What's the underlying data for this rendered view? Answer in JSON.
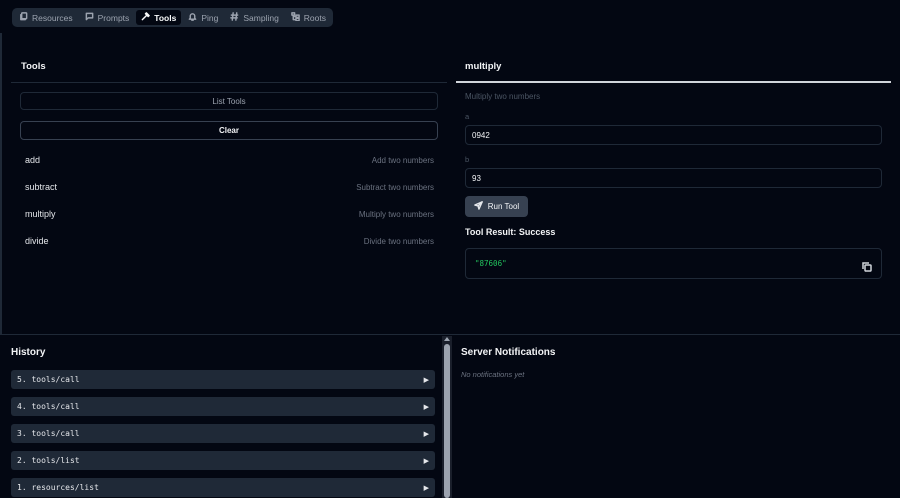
{
  "tabs": [
    {
      "label": "Resources",
      "icon": "files-icon"
    },
    {
      "label": "Prompts",
      "icon": "message-icon"
    },
    {
      "label": "Tools",
      "icon": "hammer-icon",
      "active": true
    },
    {
      "label": "Ping",
      "icon": "bell-icon"
    },
    {
      "label": "Sampling",
      "icon": "hash-icon"
    },
    {
      "label": "Roots",
      "icon": "folder-tree-icon"
    }
  ],
  "tools_panel": {
    "title": "Tools",
    "list_button": "List Tools",
    "clear_button": "Clear",
    "items": [
      {
        "name": "add",
        "description": "Add two numbers"
      },
      {
        "name": "subtract",
        "description": "Subtract two numbers"
      },
      {
        "name": "multiply",
        "description": "Multiply two numbers"
      },
      {
        "name": "divide",
        "description": "Divide two numbers"
      }
    ]
  },
  "tool_detail": {
    "title": "multiply",
    "description": "Multiply two numbers",
    "params": [
      {
        "label": "a",
        "value": "0942"
      },
      {
        "label": "b",
        "value": "93"
      }
    ],
    "run_button": "Run Tool",
    "result_title": "Tool Result: Success",
    "result_value": "\"87606\""
  },
  "history": {
    "title": "History",
    "items": [
      {
        "label": "5. tools/call"
      },
      {
        "label": "4. tools/call"
      },
      {
        "label": "3. tools/call"
      },
      {
        "label": "2. tools/list"
      },
      {
        "label": "1. resources/list"
      }
    ]
  },
  "notifications": {
    "title": "Server Notifications",
    "empty_text": "No notifications yet"
  },
  "colors": {
    "background": "#030712",
    "surface": "#1f2937",
    "success": "#22c55e"
  }
}
